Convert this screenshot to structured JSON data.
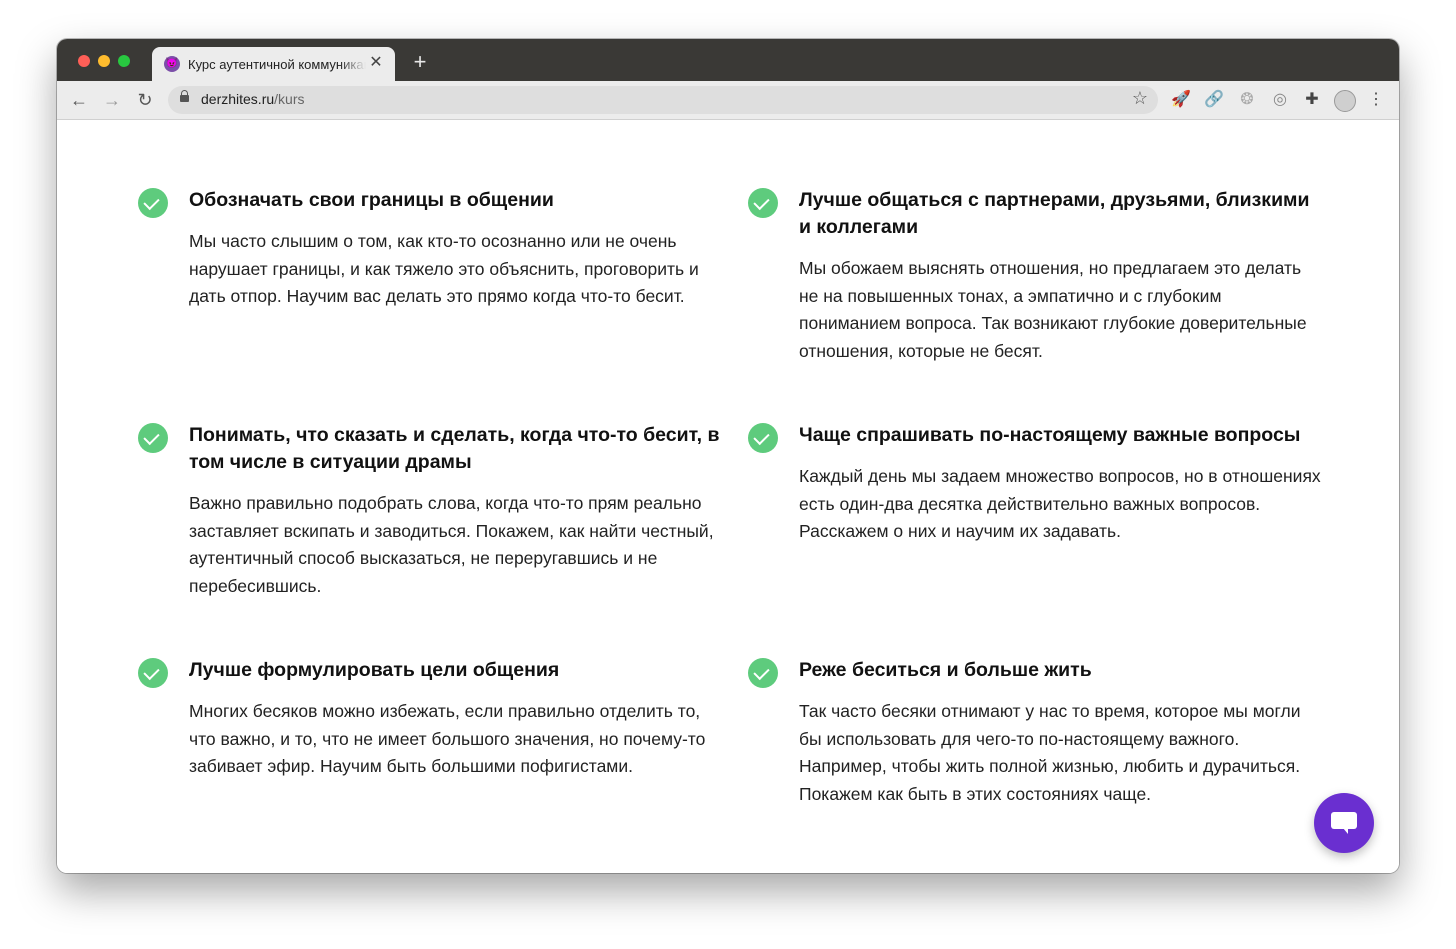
{
  "browser": {
    "tab_title": "Курс аутентичной коммуникации",
    "tab_favicon": "😈",
    "tab_close": "✕",
    "new_tab": "+",
    "url_host": "derzhites.ru",
    "url_path": "/kurs",
    "nav": {
      "back": "←",
      "forward": "→",
      "reload": "↻"
    },
    "bookmark_star": "☆",
    "extensions": [
      "rocket-icon",
      "link-icon",
      "dial-icon",
      "target-icon",
      "puzzle-icon",
      "profile-avatar",
      "more-menu-icon"
    ],
    "extension_glyphs": [
      "🚀",
      "🔗",
      "❂",
      "◎",
      "✚",
      "⋮"
    ]
  },
  "features": [
    {
      "title": "Обозначать свои границы в общении",
      "text": "Мы часто слышим о том, как кто-то осознанно или не очень нарушает границы, и как тяжело это объяснить, проговорить и дать отпор. Научим вас делать это прямо когда что-то бесит."
    },
    {
      "title": "Лучше общаться с партнерами, друзьями, близкими и коллегами",
      "text": "Мы обожаем выяснять отношения, но предлагаем это делать не на повышенных тонах, а эмпатично и с глубоким пониманием вопроса. Так возникают глубокие доверительные отношения, которые не бесят."
    },
    {
      "title": "Понимать, что сказать и сделать, когда что-то бесит, в том числе в ситуации драмы",
      "text": "Важно правильно подобрать слова, когда что-то прям реально заставляет вскипать и заводиться. Покажем, как найти честный, аутентичный способ высказаться, не переругавшись и не перебесившись."
    },
    {
      "title": "Чаще спрашивать по-настоящему важные вопросы",
      "text": "Каждый день мы задаем множество вопросов, но в отношениях есть один-два десятка действительно важных вопросов. Расскажем о них и научим их задавать."
    },
    {
      "title": "Лучше формулировать цели общения",
      "text": "Многих бесяков можно избежать, если правильно отделить то, что важно, и то, что не имеет большого значения, но почему-то забивает эфир. Научим быть большими пофигистами."
    },
    {
      "title": "Реже беситься и больше жить",
      "text": "Так часто бесяки отнимают у нас то время, которое мы могли бы использовать для чего-то по-настоящему важного. Например, чтобы жить полной жизнью, любить и дурачиться. Покажем как быть в этих состояниях чаще."
    }
  ],
  "colors": {
    "check": "#5ecb7d",
    "chat": "#6a2fd0",
    "tabbar": "#3a3936"
  }
}
